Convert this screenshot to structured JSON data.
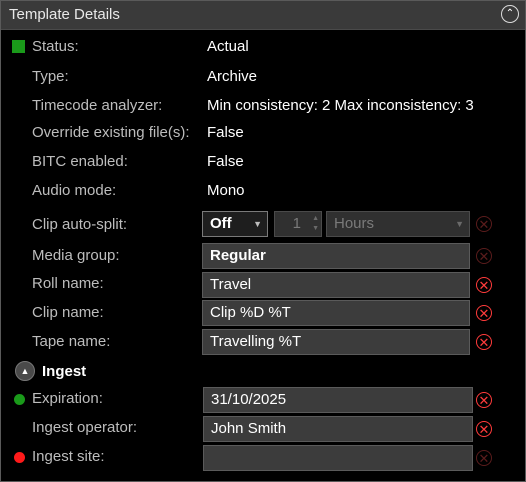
{
  "header": {
    "title": "Template Details",
    "collapse_glyph": "⌃"
  },
  "rows": {
    "status": {
      "label": "Status:",
      "value": "Actual",
      "indicator_color": "#1a9a1a"
    },
    "type": {
      "label": "Type:",
      "value": "Archive"
    },
    "timecode": {
      "label": "Timecode analyzer:",
      "value": "Min consistency: 2 Max inconsistency: 3"
    },
    "override": {
      "label": "Override existing file(s):",
      "value": "False"
    },
    "bitc": {
      "label": "BITC enabled:",
      "value": "False"
    },
    "audio": {
      "label": "Audio mode:",
      "value": "Mono"
    }
  },
  "clip_split": {
    "label": "Clip auto-split:",
    "mode": "Off",
    "count": "1",
    "unit": "Hours"
  },
  "media_group": {
    "label": "Media group:",
    "value": "Regular"
  },
  "roll_name": {
    "label": "Roll name:",
    "value": "Travel"
  },
  "clip_name": {
    "label": "Clip name:",
    "value": "Clip %D %T"
  },
  "tape_name": {
    "label": "Tape name:",
    "value": "Travelling %T"
  },
  "ingest": {
    "title": "Ingest",
    "expand_glyph": "▲",
    "expiration": {
      "label": "Expiration:",
      "value": "31/10/2025",
      "indicator_color": "#1a9a1a"
    },
    "operator": {
      "label": "Ingest operator:",
      "value": "John Smith"
    },
    "site": {
      "label": "Ingest site:",
      "value": "",
      "indicator_color": "#ff1a1a"
    }
  },
  "icons": {
    "clear": "✕",
    "dropdown": "▼",
    "spin_up": "▲",
    "spin_down": "▼"
  }
}
